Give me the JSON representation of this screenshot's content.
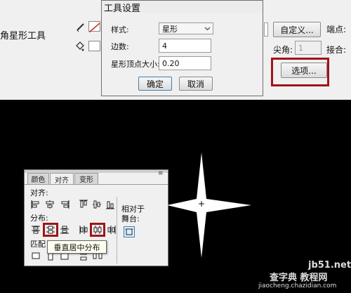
{
  "property_bar": {
    "tool_name": "角星形工具",
    "custom_button": "自定义...",
    "endpoint_label": "端点:",
    "sharp_angle_label": "尖角:",
    "sharp_angle_value": "1",
    "join_label": "接合:",
    "options_button": "选项..."
  },
  "dialog": {
    "title": "工具设置",
    "style_label": "样式:",
    "style_value": "星形",
    "sides_label": "边数:",
    "sides_value": "4",
    "vertex_label": "星形顶点大小:",
    "vertex_value": "0.20",
    "ok": "确定",
    "cancel": "取消"
  },
  "panel": {
    "tabs": [
      "颜色",
      "对齐",
      "变形"
    ],
    "align_label": "对齐:",
    "distribute_label": "分布:",
    "match_label": "匹配",
    "relative_label_1": "相对于",
    "relative_label_2": "舞台:"
  },
  "tooltip": "垂直居中分布",
  "watermark": {
    "site": "jb51.net",
    "brand": "查字典 教程网",
    "url": "jiaocheng.chazidian.com"
  },
  "colors": {
    "highlight": "#a0141a",
    "canvas": "#000000",
    "panel": "#f0f0f0"
  }
}
